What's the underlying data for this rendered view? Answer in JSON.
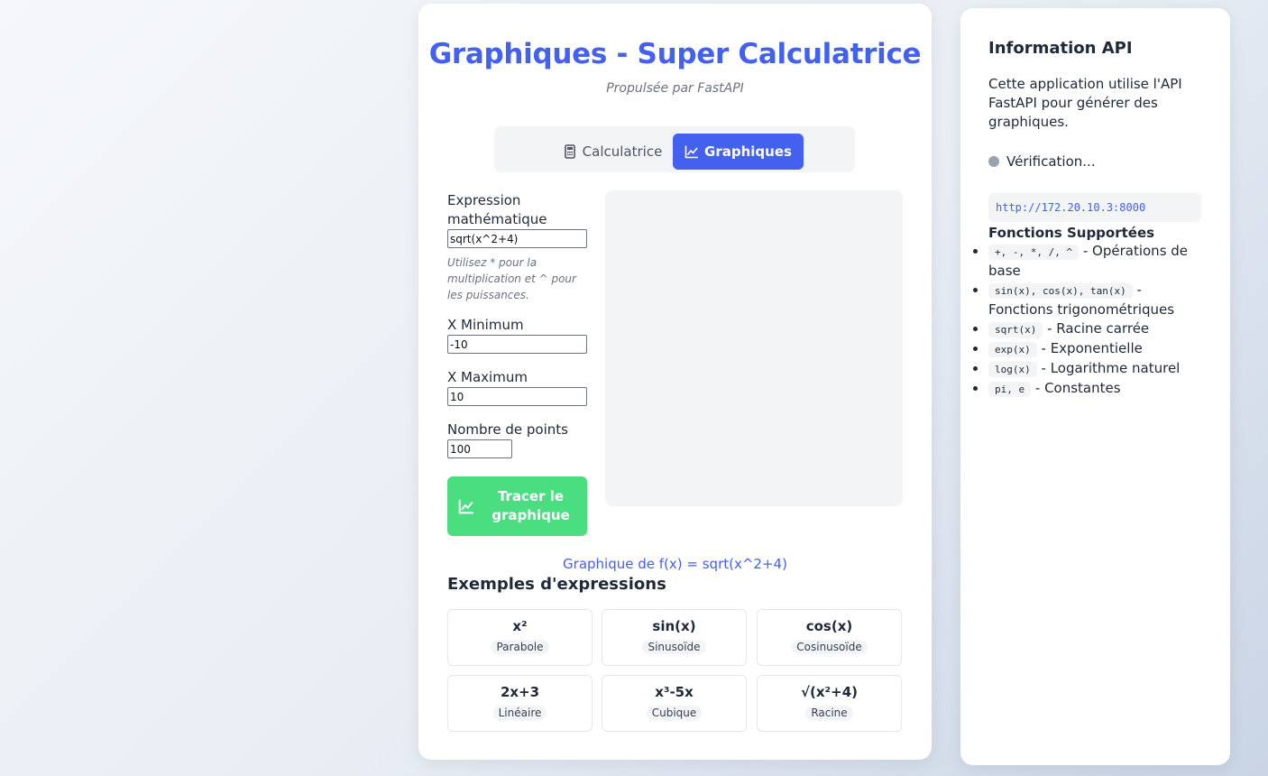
{
  "header": {
    "title": "Graphiques - Super Calculatrice",
    "subtitle": "Propulsée par FastAPI"
  },
  "tabs": [
    {
      "label": "Calculatrice",
      "icon": "calculator-icon",
      "active": false
    },
    {
      "label": "Graphiques",
      "icon": "chart-line-icon",
      "active": true
    }
  ],
  "form": {
    "expression_label": "Expression mathématique",
    "expression_value": "sqrt(x^2+4)",
    "hint": "Utilisez * pour la multiplication et ^ pour les puissances.",
    "xmin_label": "X Minimum",
    "xmin_value": "-10",
    "xmax_label": "X Maximum",
    "xmax_value": "10",
    "points_label": "Nombre de points",
    "points_value": "100",
    "plot_button": "Tracer le graphique"
  },
  "graph_caption": "Graphique de f(x) = sqrt(x^2+4)",
  "examples": {
    "title": "Exemples d'expressions",
    "items": [
      {
        "expr": "x²",
        "tag": "Parabole"
      },
      {
        "expr": "sin(x)",
        "tag": "Sinusoïde"
      },
      {
        "expr": "cos(x)",
        "tag": "Cosinusoïde"
      },
      {
        "expr": "2x+3",
        "tag": "Linéaire"
      },
      {
        "expr": "x³-5x",
        "tag": "Cubique"
      },
      {
        "expr": "√(x²+4)",
        "tag": "Racine"
      }
    ]
  },
  "sidebar": {
    "title": "Information API",
    "description": "Cette application utilise l'API FastAPI pour générer des graphiques.",
    "status": "Vérification...",
    "status_color": "#9ca3af",
    "api_url": "http://172.20.10.3:8000",
    "functions_title": "Fonctions Supportées",
    "functions": [
      {
        "code": "+, -, *, /, ^",
        "desc": " - Opérations de base"
      },
      {
        "code": "sin(x), cos(x), tan(x)",
        "desc": " - Fonctions trigonométriques"
      },
      {
        "code": "sqrt(x)",
        "desc": " - Racine carrée"
      },
      {
        "code": "exp(x)",
        "desc": " - Exponentielle"
      },
      {
        "code": "log(x)",
        "desc": " - Logarithme naturel"
      },
      {
        "code": "pi, e",
        "desc": " - Constantes"
      }
    ]
  },
  "colors": {
    "accent": "#4361ee",
    "success": "#4ade80"
  }
}
